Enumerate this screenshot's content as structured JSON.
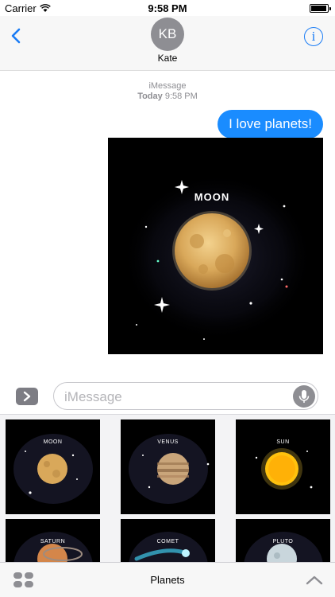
{
  "status_bar": {
    "carrier": "Carrier",
    "time": "9:58 PM"
  },
  "nav": {
    "avatar_initials": "KB",
    "contact_name": "Kate"
  },
  "conversation": {
    "service": "iMessage",
    "date": "Today",
    "time": "9:58 PM",
    "message": "I love planets!",
    "sticker_label": "MOON"
  },
  "input": {
    "placeholder": "iMessage"
  },
  "drawer": {
    "stickers": [
      "MOON",
      "VENUS",
      "SUN",
      "SATURN",
      "COMET",
      "PLUTO"
    ]
  },
  "bottom_bar": {
    "title": "Planets"
  },
  "colors": {
    "accent": "#1a7cf5",
    "bubble": "#1a8cff",
    "moon": "#d9a85a",
    "sun": "#ffc20e"
  }
}
